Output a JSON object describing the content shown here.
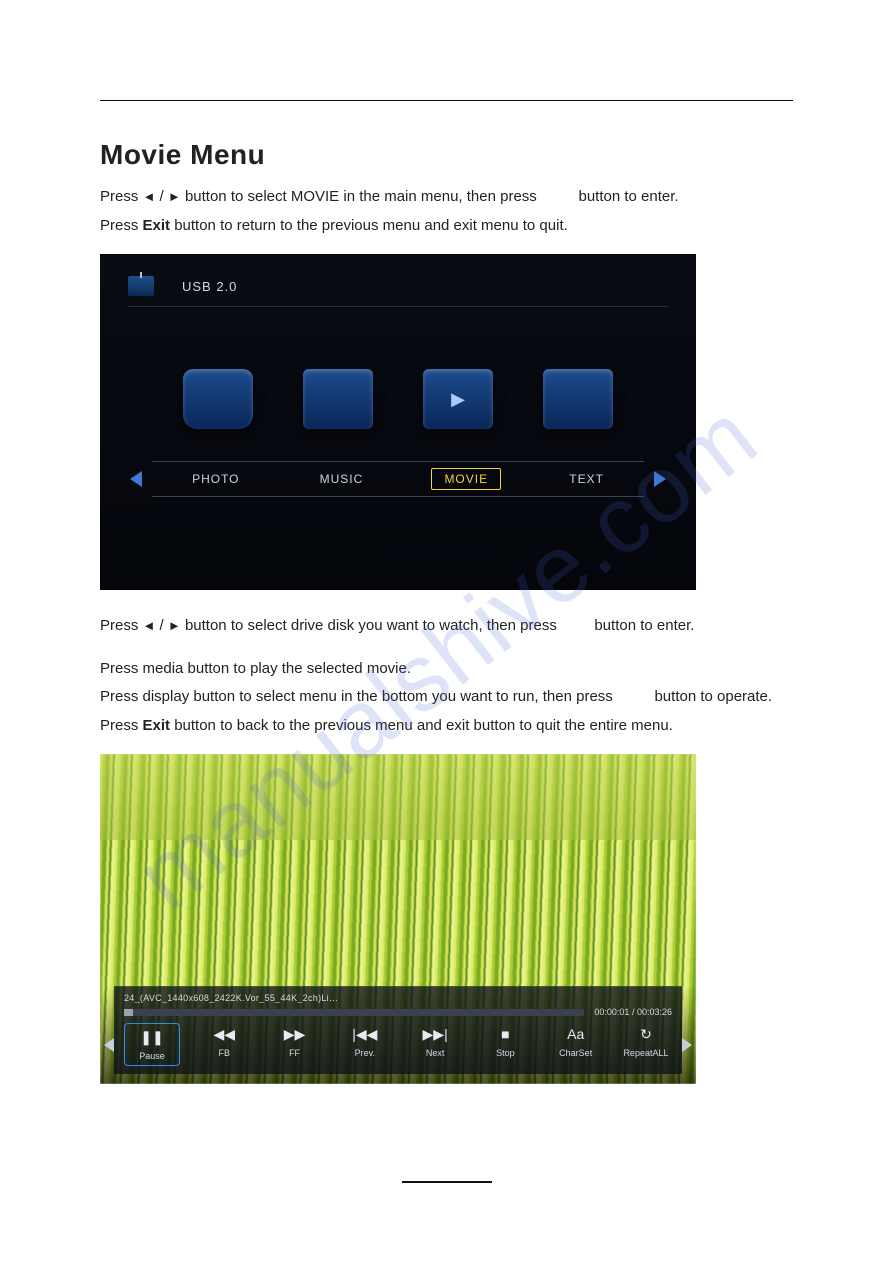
{
  "title": "Movie Menu",
  "para1_pre": "Press ",
  "tri_left": "◄",
  "slash": " / ",
  "tri_right": "►",
  "para1_mid": " button to select MOVIE in the main menu,  then press ",
  "para1_post": " button to enter.",
  "para2_pre": "Press ",
  "exit_bold": "Exit",
  "para2_post": " button to return to the previous menu and exit menu to quit.",
  "menu": {
    "source_label": "USB 2.0",
    "categories": [
      {
        "label": "PHOTO",
        "selected": false
      },
      {
        "label": "MUSIC",
        "selected": false
      },
      {
        "label": "MOVIE",
        "selected": true
      },
      {
        "label": "TEXT",
        "selected": false
      }
    ]
  },
  "para3_pre": "Press ",
  "para3_mid": " button to select drive disk you want to watch, then press ",
  "para3_post": " button to enter.",
  "para4": "Press media button to play the selected movie.",
  "para5_pre": "Press display button to select menu in the bottom you want to run,  then press ",
  "para5_post": " button to operate.",
  "para6_pre": "Press ",
  "para6_post": " button to back to the previous menu and exit button to quit the entire menu.",
  "player": {
    "filename": "24_(AVC_1440x608_2422K.Vor_55_44K_2ch)Li…",
    "elapsed": "00:00:01",
    "time_sep": " / ",
    "duration": "00:03:26",
    "controls": [
      {
        "name": "pause",
        "label": "Pause",
        "glyph": "❚❚",
        "selected": true
      },
      {
        "name": "fb",
        "label": "FB",
        "glyph": "◀◀",
        "selected": false
      },
      {
        "name": "ff",
        "label": "FF",
        "glyph": "▶▶",
        "selected": false
      },
      {
        "name": "prev",
        "label": "Prev.",
        "glyph": "|◀◀",
        "selected": false
      },
      {
        "name": "next",
        "label": "Next",
        "glyph": "▶▶|",
        "selected": false
      },
      {
        "name": "stop",
        "label": "Stop",
        "glyph": "■",
        "selected": false
      },
      {
        "name": "charset",
        "label": "CharSet",
        "glyph": "Aa",
        "selected": false
      },
      {
        "name": "repeatall",
        "label": "RepeatALL",
        "glyph": "↻",
        "selected": false
      }
    ]
  },
  "watermark": "manualshive.com"
}
